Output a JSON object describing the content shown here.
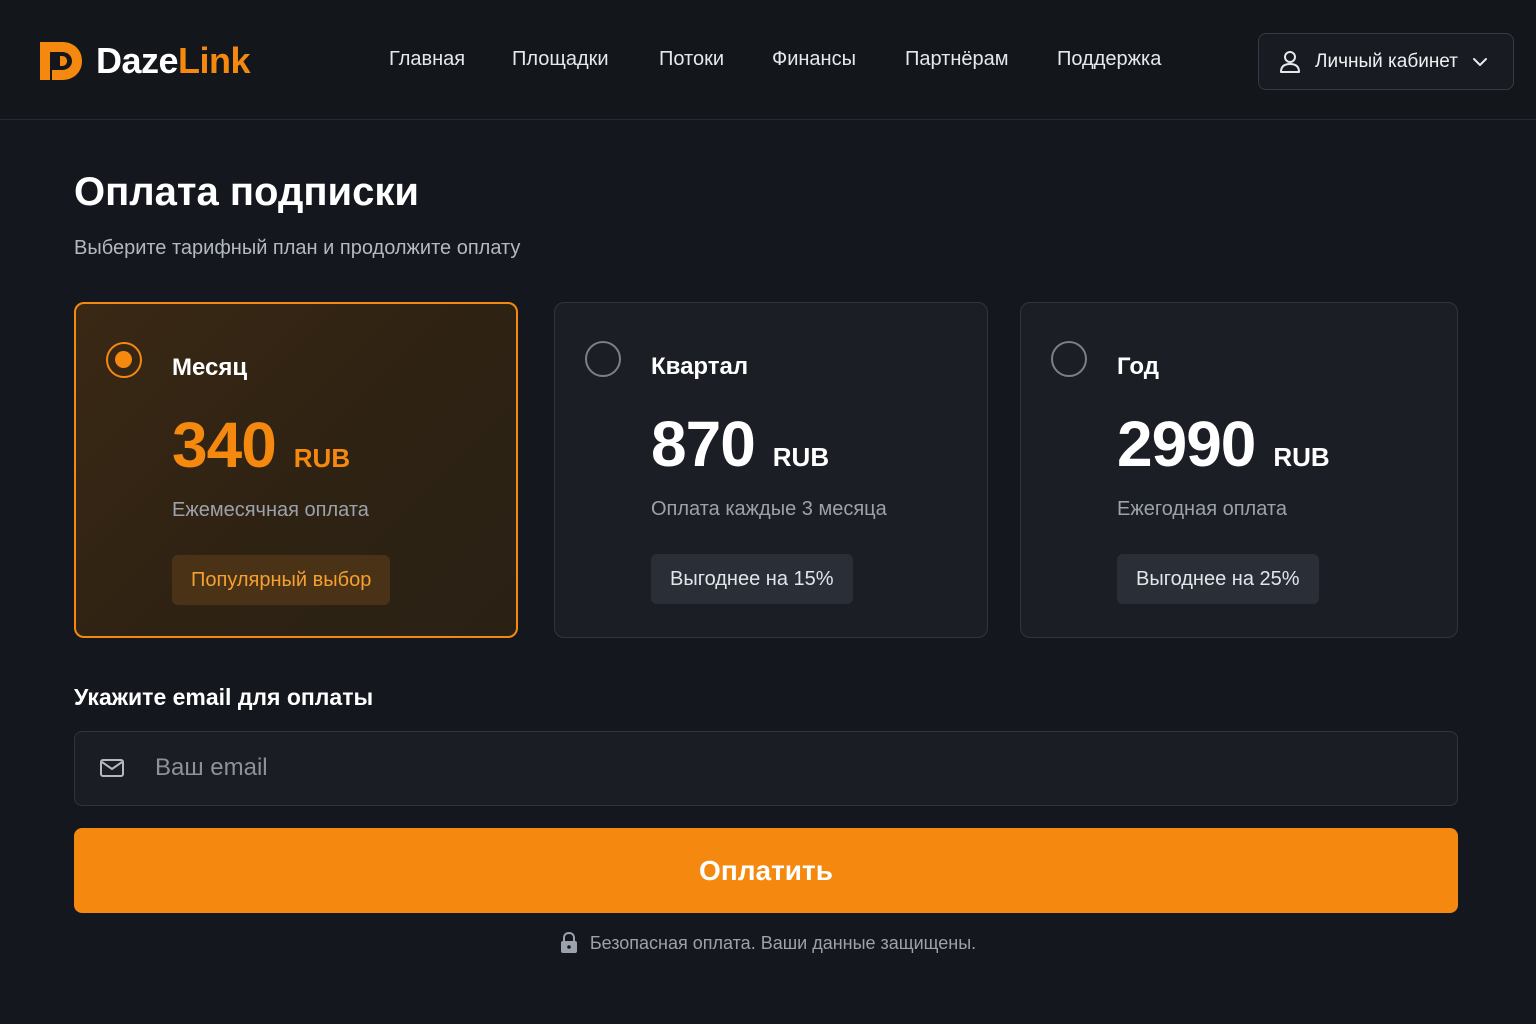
{
  "brand": {
    "part1": "Daze",
    "part2": "Link",
    "accent": "#f5890f"
  },
  "nav": {
    "items": [
      {
        "label": "Главная"
      },
      {
        "label": "Площадки"
      },
      {
        "label": "Потоки"
      },
      {
        "label": "Финансы"
      },
      {
        "label": "Партнёрам"
      },
      {
        "label": "Поддержка"
      }
    ]
  },
  "account": {
    "label": "Личный кабинет",
    "icon": "user-icon",
    "chevron": "chevron-down-icon"
  },
  "page": {
    "title": "Оплата подписки",
    "subtitle": "Выберите тарифный план и продолжите оплату"
  },
  "plans": [
    {
      "name": "Месяц",
      "price": "340",
      "currency": "RUB",
      "description": "Ежемесячная оплата",
      "badge": "Популярный выбор",
      "selected": true
    },
    {
      "name": "Квартал",
      "price": "870",
      "currency": "RUB",
      "description": "Оплата каждые 3 месяца",
      "badge": "Выгоднее на 15%",
      "selected": false
    },
    {
      "name": "Год",
      "price": "2990",
      "currency": "RUB",
      "description": "Ежегодная оплата",
      "badge": "Выгоднее на 25%",
      "selected": false
    }
  ],
  "email": {
    "label": "Укажите email для оплаты",
    "placeholder": "Ваш email",
    "value": "",
    "icon": "mail-icon"
  },
  "pay_button": {
    "label": "Оплатить",
    "color": "#f5890f"
  },
  "secure_note": {
    "text": "Безопасная оплата. Ваши данные защищены.",
    "icon": "lock-icon"
  }
}
